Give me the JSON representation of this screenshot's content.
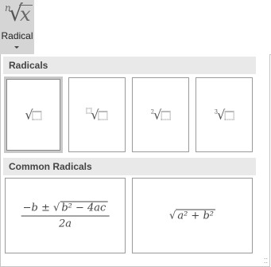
{
  "ribbon": {
    "icon": "radical-icon",
    "icon_glyph": "√",
    "icon_index": "n",
    "icon_var": "x",
    "label": "Radical"
  },
  "sections": [
    {
      "title": "Radicals",
      "items": [
        {
          "name": "square-root",
          "index": "",
          "selected": true
        },
        {
          "name": "radical-with-degree",
          "index": "□",
          "selected": false
        },
        {
          "name": "square-root-with-degree",
          "index": "2",
          "selected": false
        },
        {
          "name": "cube-root",
          "index": "3",
          "selected": false
        }
      ]
    },
    {
      "title": "Common Radicals",
      "items": [
        {
          "name": "quadratic-formula",
          "numerator": "−b ± √(b² − 4ac)",
          "numerator_left": "−b ± ",
          "numerator_sqrt": "b² − 4ac",
          "denominator": "2a"
        },
        {
          "name": "pythagorean-sqrt",
          "expression": "a² + b²"
        }
      ]
    }
  ],
  "grip": "⁚⁚"
}
